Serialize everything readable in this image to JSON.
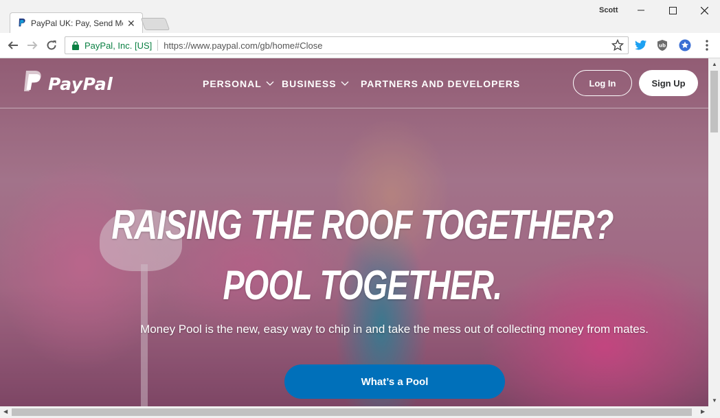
{
  "browser": {
    "tab_title": "PayPal UK: Pay, Send Mo",
    "profile_name": "Scott",
    "site_identity": "PayPal, Inc. [US]",
    "url": "https://www.paypal.com/gb/home#Close"
  },
  "header": {
    "logo_text": "PayPal",
    "nav": {
      "personal": "PERSONAL",
      "business": "BUSINESS",
      "partners": "PARTNERS AND DEVELOPERS"
    },
    "login_label": "Log In",
    "signup_label": "Sign Up"
  },
  "hero": {
    "headline_line1": "RAISING THE ROOF TOGETHER?",
    "headline_line2": "POOL TOGETHER.",
    "subtitle": "Money Pool is the new, easy way to chip in and take the mess out of collecting money from mates.",
    "cta_label": "What’s a Pool"
  },
  "colors": {
    "paypal_blue": "#0070ba",
    "secure_green": "#0b8043",
    "twitter_blue": "#1da1f2"
  },
  "icons": [
    "paypal-favicon",
    "close-icon",
    "back-arrow-icon",
    "forward-arrow-icon",
    "reload-icon",
    "lock-icon",
    "bookmark-star-icon",
    "twitter-icon",
    "shield-extension-icon",
    "star-badge-icon",
    "menu-dots-icon",
    "chevron-down-icon",
    "paypal-logo-icon"
  ]
}
